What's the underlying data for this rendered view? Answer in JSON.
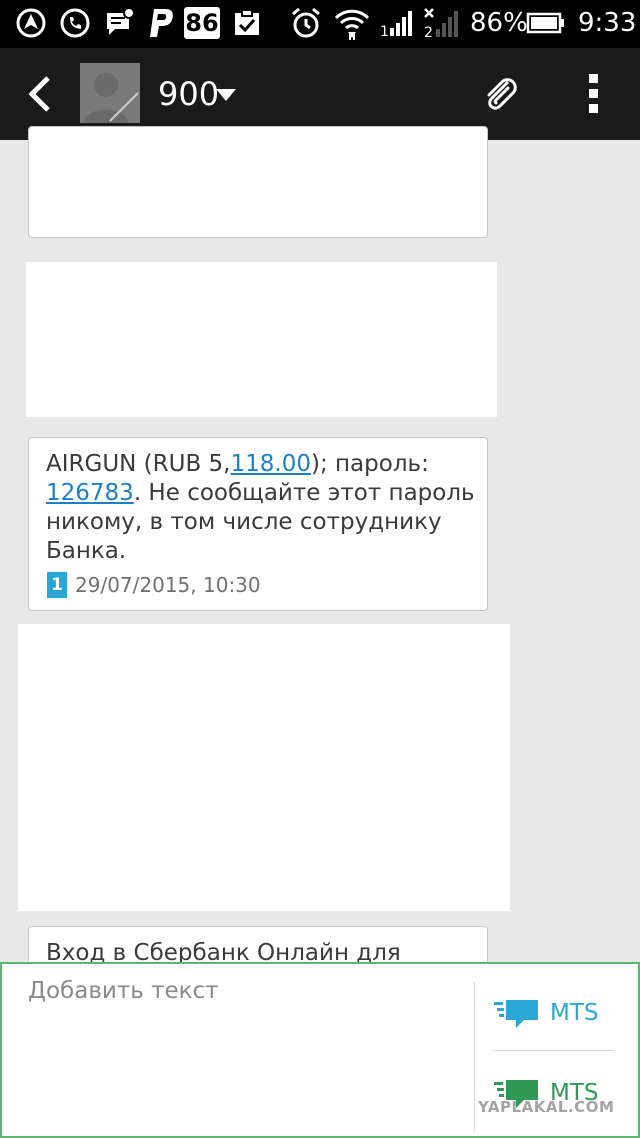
{
  "status_bar": {
    "notification_count": "86",
    "battery_percent": "86%",
    "time": "9:33"
  },
  "header": {
    "contact_name": "900"
  },
  "messages": [
    {
      "text_before": "AIRGUN (RUB 5,",
      "link_amount": "118.00",
      "text_middle": "); пароль:",
      "link_code": "126783",
      "text_after": ". Не сообщайте этот пароль никому, в том числе сотруднику Банка.",
      "sim": "1",
      "timestamp": "29/07/2015, 10:30"
    },
    {
      "text": "Вход в Сбербанк Онлайн для Android"
    }
  ],
  "composer": {
    "placeholder": "Добавить текст",
    "send_sim1_label": "MTS",
    "send_sim2_label": "MTS"
  },
  "watermark": "YAPLAKAL.COM",
  "colors": {
    "accent_blue": "#2aa7d6",
    "accent_green": "#2e9a55",
    "link": "#1e7fc5"
  }
}
